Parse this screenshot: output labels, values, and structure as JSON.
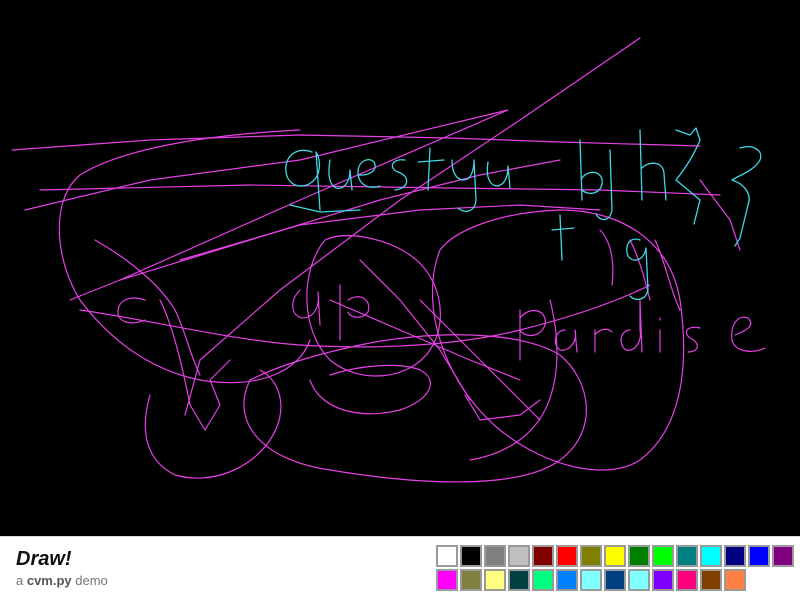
{
  "app": {
    "title": "Draw!",
    "subtitle_prefix": "a ",
    "subtitle_name": "cvm.py",
    "subtitle_suffix": " demo"
  },
  "canvas": {
    "background": "#000000",
    "stroke_colors": [
      "#e640e6",
      "#40d8e8",
      "#c04ad8"
    ]
  },
  "palette": {
    "swatches": [
      "#ffffff",
      "#000000",
      "#808080",
      "#c0c0c0",
      "#800000",
      "#ff0000",
      "#808000",
      "#ffff00",
      "#008000",
      "#00ff00",
      "#008080",
      "#00ffff",
      "#000080",
      "#0000ff",
      "#800080",
      "#ff00ff",
      "#808040",
      "#ffff80",
      "#004040",
      "#00ff80",
      "#0080ff",
      "#80ffff",
      "#004080",
      "#80ffff",
      "#8000ff",
      "#ff0080",
      "#804000",
      "#ff8040"
    ]
  }
}
